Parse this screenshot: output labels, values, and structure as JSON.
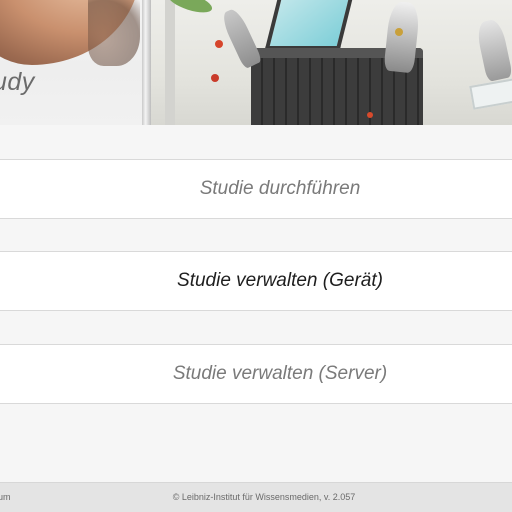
{
  "header": {
    "title_fragment": "udy"
  },
  "menu": {
    "items": [
      {
        "label": "Studie durchführen",
        "state": "muted"
      },
      {
        "label": "Studie verwalten (Gerät)",
        "state": "active"
      },
      {
        "label": "Studie verwalten (Server)",
        "state": "muted"
      }
    ]
  },
  "footer": {
    "left_link_fragment": "um",
    "copyright": "© Leibniz-Institut für Wissensmedien, v. 2.057"
  },
  "colors": {
    "page_background": "#f6f6f6",
    "row_background": "#ffffff",
    "muted_text": "#7a7a7a",
    "active_text": "#1e1e1e",
    "footer_background": "#e4e4e4"
  }
}
